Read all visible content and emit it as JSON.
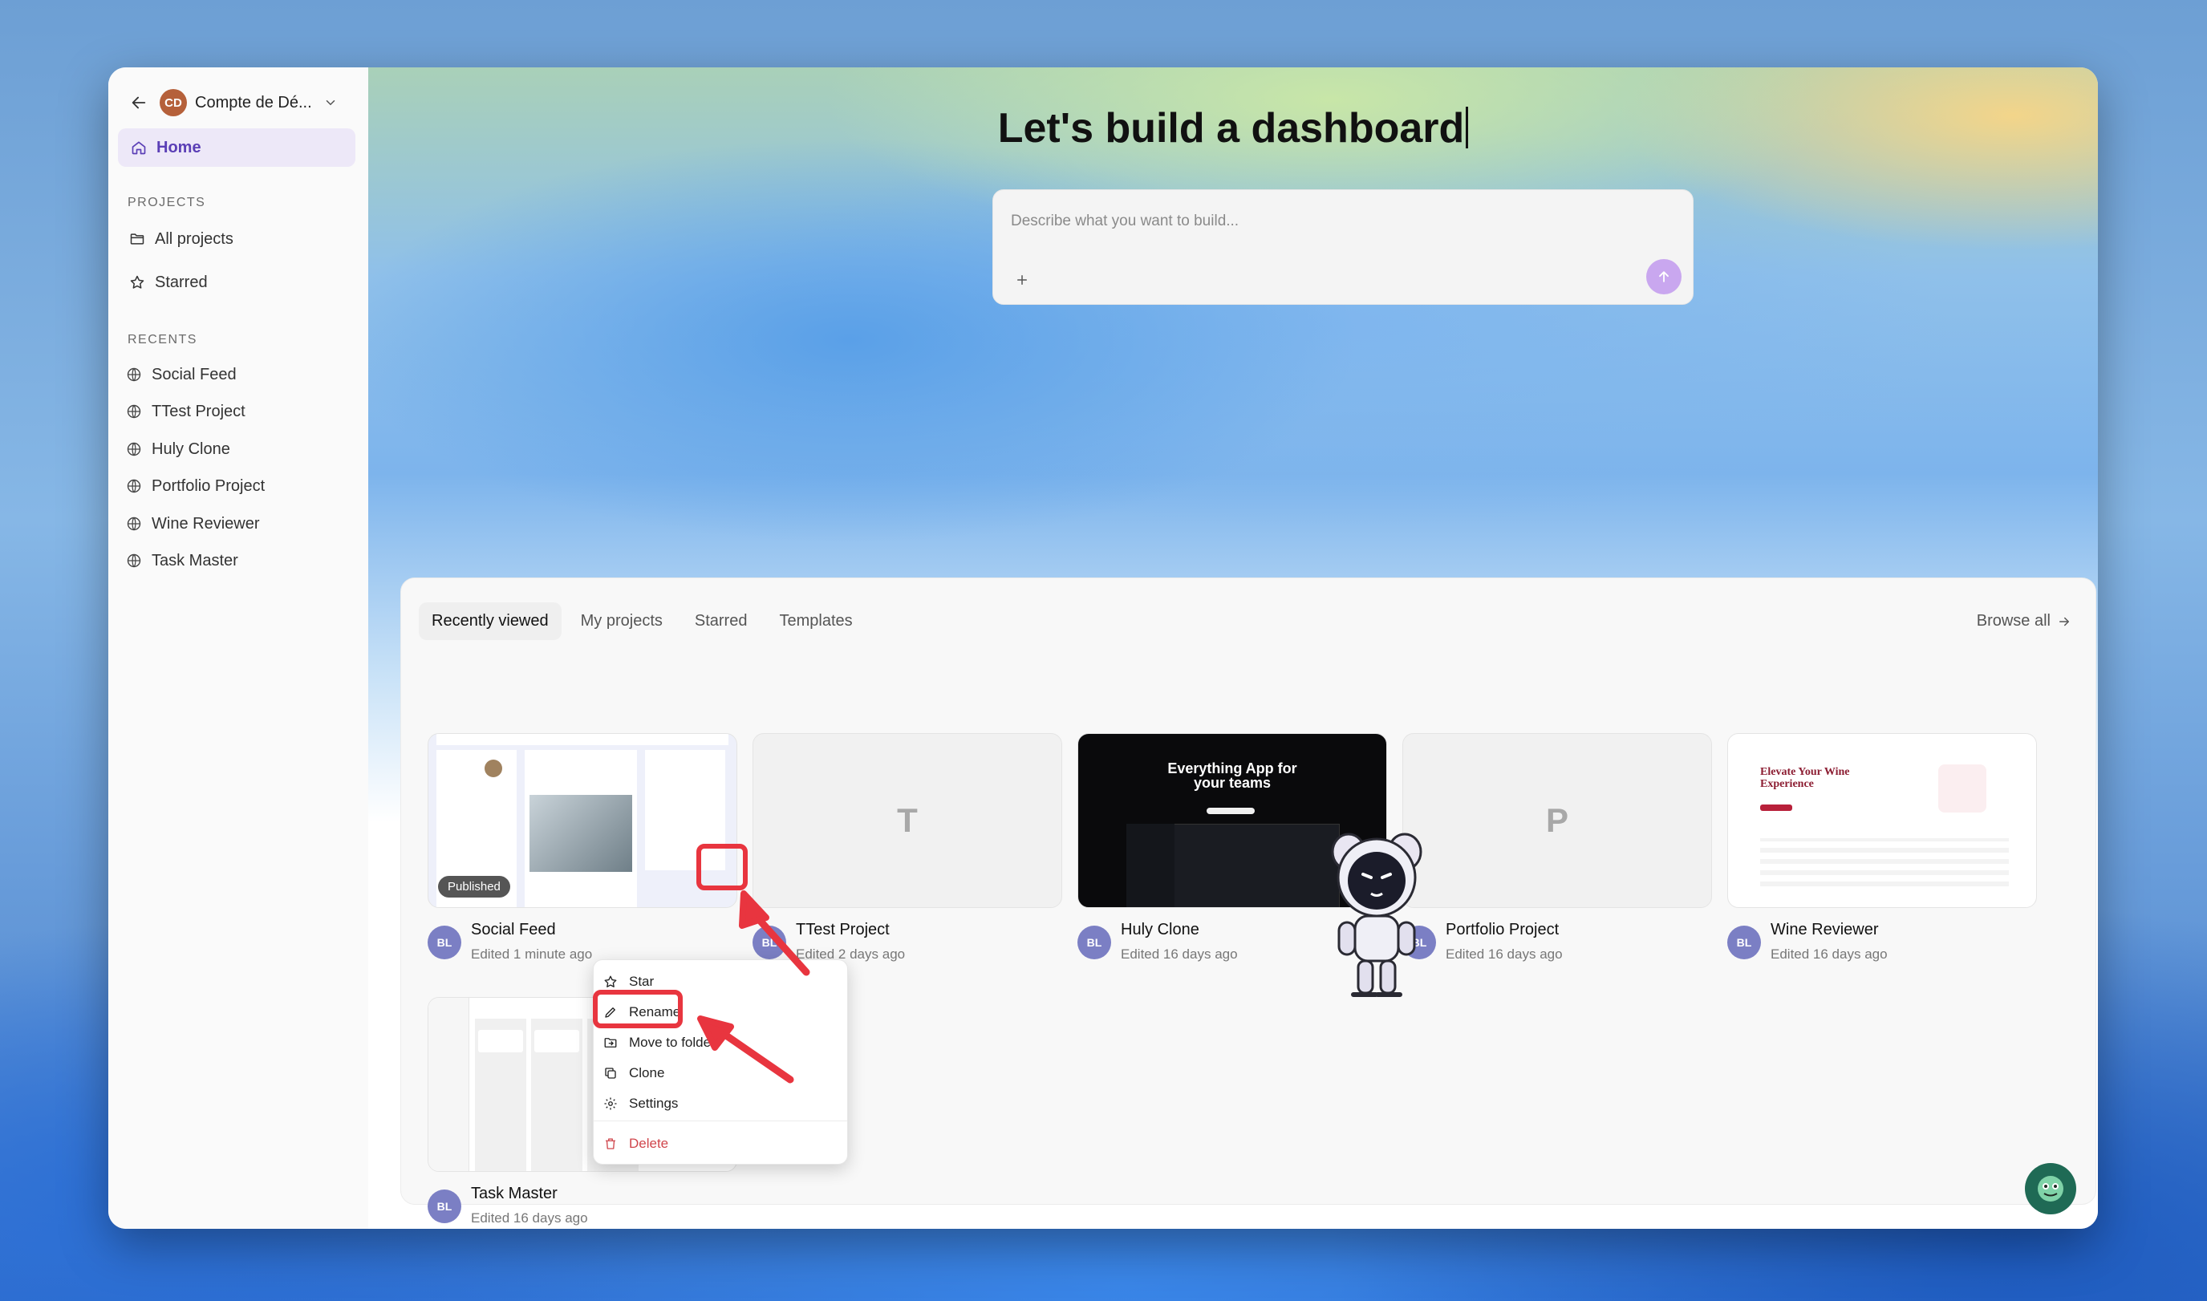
{
  "account": {
    "name": "Compte de Dé...",
    "initials": "CD"
  },
  "sidebar": {
    "home_label": "Home",
    "projects_heading": "PROJECTS",
    "projects_items": [
      {
        "label": "All projects",
        "icon": "folder-icon"
      },
      {
        "label": "Starred",
        "icon": "star-icon"
      }
    ],
    "recents_heading": "RECENTS",
    "recents": [
      "Social Feed",
      "TTest Project",
      "Huly Clone",
      "Portfolio Project",
      "Wine Reviewer",
      "Task Master"
    ]
  },
  "hero": {
    "title": "Let's build a dashboard",
    "placeholder": "Describe what you want to build..."
  },
  "tabs": [
    "Recently viewed",
    "My projects",
    "Starred",
    "Templates"
  ],
  "browse_all": "Browse all",
  "projects": [
    {
      "name": "Social Feed",
      "edited": "Edited 1 minute ago",
      "owner": "BL",
      "badge": "Published"
    },
    {
      "name": "TTest Project",
      "edited": "Edited 2 days ago",
      "owner": "BL",
      "letter": "T"
    },
    {
      "name": "Huly Clone",
      "edited": "Edited 16 days ago",
      "owner": "BL",
      "hero_text": "Everything App for your teams"
    },
    {
      "name": "Portfolio Project",
      "edited": "Edited 16 days ago",
      "owner": "BL",
      "letter": "P"
    },
    {
      "name": "Wine Reviewer",
      "edited": "Edited 16 days ago",
      "owner": "BL",
      "hero_text": "Elevate Your Wine Experience"
    },
    {
      "name": "Task Master",
      "edited": "Edited 16 days ago",
      "owner": "BL"
    }
  ],
  "context_menu": [
    "Star",
    "Rename",
    "Move to folder",
    "Clone",
    "Settings",
    "Delete"
  ],
  "colors": {
    "accent": "#5b3fb6",
    "annotation_red": "#e8353f",
    "avatar": "#7b7fc4",
    "send_button": "#c9a7ef"
  }
}
